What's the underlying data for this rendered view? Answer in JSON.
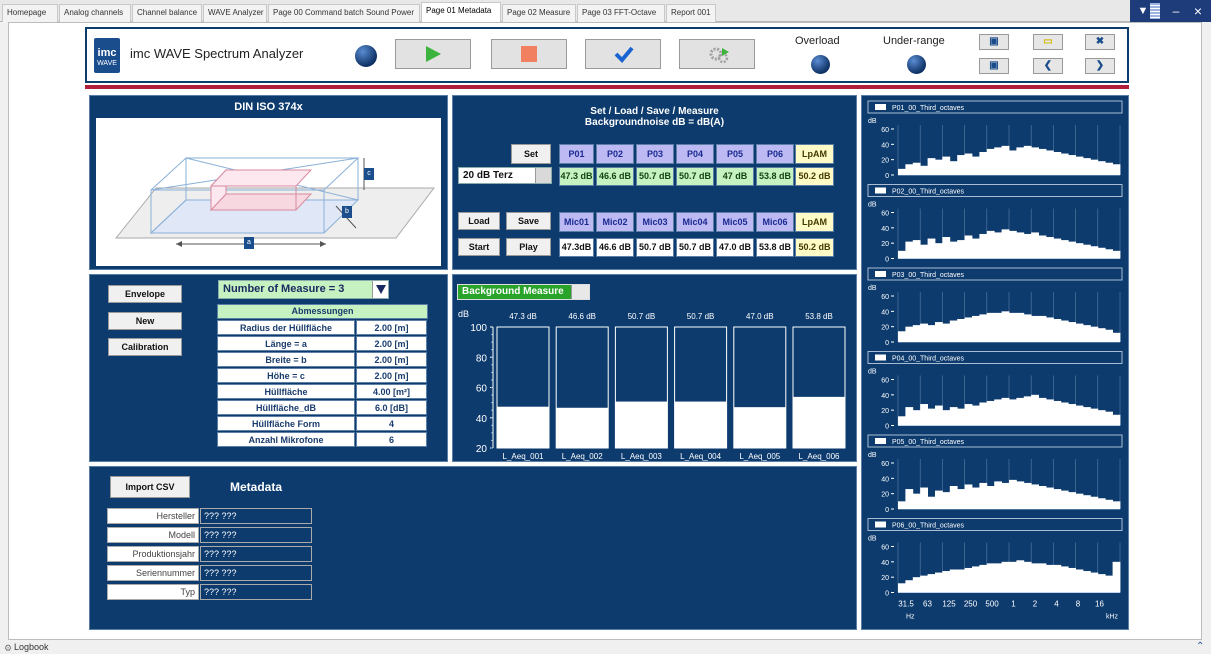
{
  "tabs": [
    "Homepage",
    "Analog channels",
    "Channel balance",
    "WAVE Analyzer",
    "Page 00 Command batch Sound Power",
    "Page 01 Metadata",
    "Page 02 Measure",
    "Page 03 FFT-Octave",
    "Report 001"
  ],
  "active_tab": 5,
  "window_controls": {
    "menu": "▼",
    "minimize": "–",
    "close": "×"
  },
  "header": {
    "logo_top": "imc",
    "logo_bottom": "WAVE",
    "title": "imc WAVE Spectrum Analyzer",
    "overload_label": "Overload",
    "underrange_label": "Under-range"
  },
  "colors": {
    "panel_bg": "#0d3b6e",
    "accent_red": "#b01e3c",
    "play_green": "#3cb33c",
    "stop_orange": "#f08060",
    "check_blue": "#1a64d0"
  },
  "din_panel": {
    "title": "DIN ISO 374x",
    "dim_labels": [
      "a",
      "b",
      "c"
    ]
  },
  "set_panel": {
    "title_line1": "Set / Load / Save / Measure",
    "title_line2": "Backgroundnoise dB = dB(A)",
    "set_label": "Set",
    "load_label": "Load",
    "save_label": "Save",
    "start_label": "Start",
    "play_label": "Play",
    "filter_value": "20 dB Terz",
    "position_headers": [
      "P01",
      "P02",
      "P03",
      "P04",
      "P05",
      "P06",
      "LpAM"
    ],
    "position_values": [
      "47.3 dB",
      "46.6 dB",
      "50.7 dB",
      "50.7 dB",
      "47 dB",
      "53.8 dB",
      "50.2 dB"
    ],
    "mic_headers": [
      "Mic01",
      "Mic02",
      "Mic03",
      "Mic04",
      "Mic05",
      "Mic06",
      "LpAM"
    ],
    "mic_values": [
      "47.3dB",
      "46.6 dB",
      "50.7 dB",
      "50.7 dB",
      "47.0 dB",
      "53.8 dB",
      "50.2 dB"
    ]
  },
  "measure_panel": {
    "envelope_label": "Envelope",
    "new_label": "New",
    "calibration_label": "Calibration",
    "number_select": "Number of Measure = 3",
    "table_header": "Abmessungen",
    "rows": [
      {
        "label": "Radius der Hüllfläche",
        "value": "2.00 [m]"
      },
      {
        "label": "Länge = a",
        "value": "2.00 [m]"
      },
      {
        "label": "Breite = b",
        "value": "2.00 [m]"
      },
      {
        "label": "Höhe = c",
        "value": "2.00 [m]"
      },
      {
        "label": "Hüllfläche",
        "value": "4.00 [m²]"
      },
      {
        "label": "Hüllfläche_dB",
        "value": "6.0 [dB]"
      },
      {
        "label": "Hüllfläche Form",
        "value": "4"
      },
      {
        "label": "Anzahl Mikrofone",
        "value": "6"
      }
    ]
  },
  "bg_panel": {
    "select_label": "Background Measure"
  },
  "chart_data": [
    {
      "type": "bar",
      "categories": [
        "L_Aeq_001",
        "L_Aeq_002",
        "L_Aeq_003",
        "L_Aeq_004",
        "L_Aeq_005",
        "L_Aeq_006"
      ],
      "values": [
        47.3,
        46.6,
        50.7,
        50.7,
        47.0,
        53.8
      ],
      "value_labels": [
        "47.3 dB",
        "46.6 dB",
        "50.7 dB",
        "50.7 dB",
        "47.0 dB",
        "53.8 dB"
      ],
      "ylabel": "dB",
      "ylim": [
        20,
        100
      ],
      "yticks": [
        "20",
        "40",
        "60",
        "80",
        "100"
      ]
    },
    {
      "type": "bar",
      "series_name": "P01_00_Third_octaves",
      "ylabel": "dB",
      "ylim": [
        0,
        60
      ],
      "yticks": [
        "0",
        "20",
        "40",
        "60"
      ],
      "values": [
        8,
        14,
        16,
        12,
        22,
        20,
        24,
        18,
        26,
        28,
        24,
        30,
        34,
        36,
        38,
        32,
        36,
        38,
        36,
        34,
        32,
        30,
        28,
        26,
        24,
        22,
        20,
        18,
        16,
        14
      ]
    },
    {
      "type": "bar",
      "series_name": "P02_00_Third_octaves",
      "ylabel": "dB",
      "ylim": [
        0,
        60
      ],
      "yticks": [
        "0",
        "20",
        "40",
        "60"
      ],
      "values": [
        10,
        22,
        24,
        18,
        26,
        20,
        28,
        22,
        24,
        30,
        26,
        32,
        36,
        34,
        38,
        36,
        34,
        32,
        34,
        30,
        28,
        26,
        24,
        22,
        20,
        18,
        16,
        14,
        12,
        10
      ]
    },
    {
      "type": "bar",
      "series_name": "P03_00_Third_octaves",
      "ylabel": "dB",
      "ylim": [
        0,
        60
      ],
      "yticks": [
        "0",
        "20",
        "40",
        "60"
      ],
      "values": [
        14,
        20,
        22,
        24,
        22,
        26,
        24,
        28,
        30,
        32,
        34,
        36,
        38,
        38,
        40,
        38,
        38,
        36,
        34,
        34,
        32,
        30,
        28,
        26,
        24,
        22,
        20,
        18,
        16,
        12
      ]
    },
    {
      "type": "bar",
      "series_name": "P04_00_Third_octaves",
      "ylabel": "dB",
      "ylim": [
        0,
        60
      ],
      "yticks": [
        "0",
        "20",
        "40",
        "60"
      ],
      "values": [
        12,
        24,
        20,
        28,
        22,
        26,
        20,
        24,
        22,
        28,
        26,
        30,
        32,
        34,
        36,
        34,
        36,
        38,
        40,
        36,
        34,
        32,
        30,
        28,
        26,
        24,
        22,
        20,
        18,
        14
      ]
    },
    {
      "type": "bar",
      "series_name": "P05_00_Third_octaves",
      "ylabel": "dB",
      "ylim": [
        0,
        60
      ],
      "yticks": [
        "0",
        "20",
        "40",
        "60"
      ],
      "values": [
        10,
        26,
        20,
        28,
        16,
        24,
        22,
        30,
        26,
        32,
        28,
        34,
        30,
        36,
        34,
        38,
        36,
        34,
        32,
        30,
        28,
        26,
        24,
        22,
        20,
        18,
        16,
        14,
        12,
        10
      ]
    },
    {
      "type": "bar",
      "series_name": "P06_00_Third_octaves",
      "ylabel": "dB",
      "ylim": [
        0,
        60
      ],
      "yticks": [
        "0",
        "20",
        "40",
        "60"
      ],
      "xticks": [
        "31.5",
        "63",
        "125",
        "250",
        "500",
        "1",
        "2",
        "4",
        "8",
        "16"
      ],
      "xunit_left": "Hz",
      "xunit_right": "kHz",
      "values": [
        12,
        16,
        20,
        22,
        24,
        26,
        28,
        30,
        30,
        32,
        34,
        36,
        38,
        38,
        40,
        40,
        42,
        40,
        38,
        38,
        36,
        36,
        34,
        32,
        30,
        28,
        26,
        24,
        22,
        40
      ]
    }
  ],
  "metadata_panel": {
    "import_label": "Import CSV",
    "title": "Metadata",
    "rows": [
      {
        "label": "Hersteller",
        "value": "??? ???"
      },
      {
        "label": "Modell",
        "value": "??? ???"
      },
      {
        "label": "Produktionsjahr",
        "value": "??? ???"
      },
      {
        "label": "Seriennummer",
        "value": "??? ???"
      },
      {
        "label": "Typ",
        "value": "??? ???"
      }
    ]
  },
  "footer": {
    "logbook_label": "Logbook"
  }
}
